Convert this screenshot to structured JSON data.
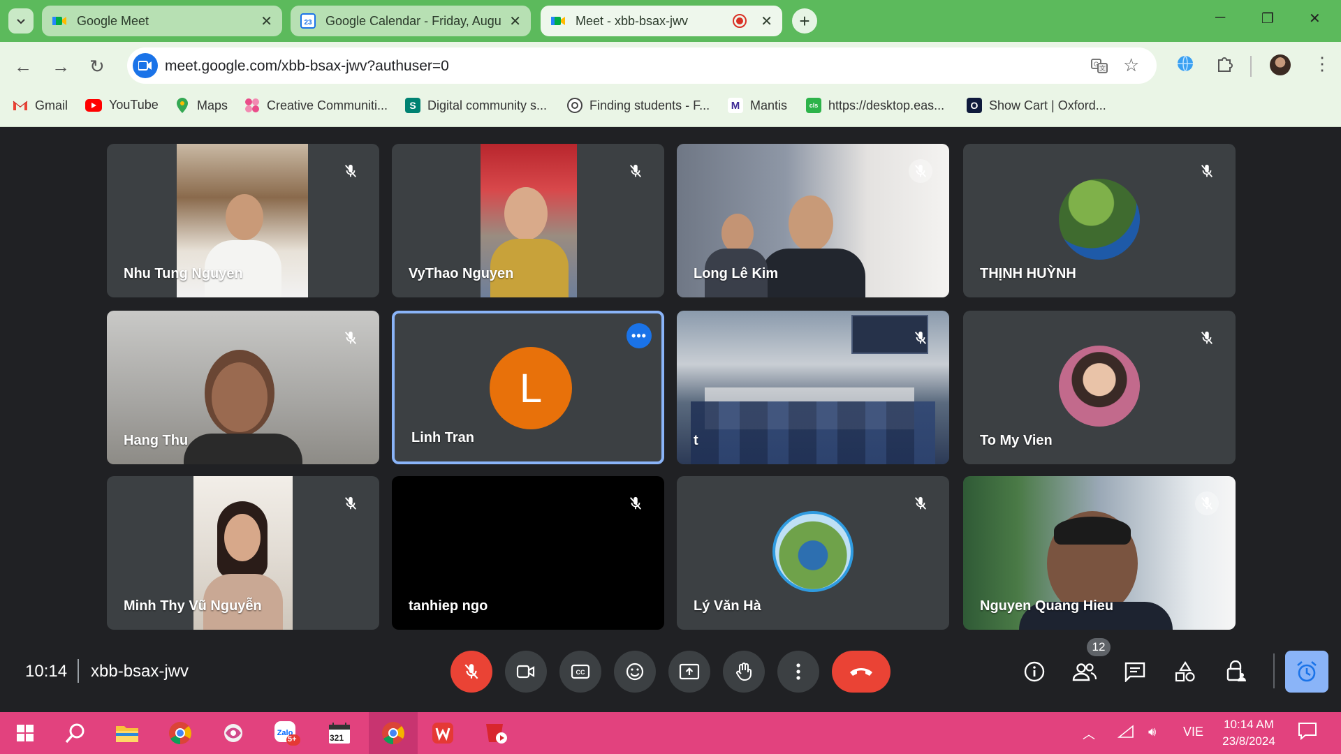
{
  "browser": {
    "tabs": [
      {
        "title": "Google Meet",
        "active": false
      },
      {
        "title": "Google Calendar - Friday, Augu",
        "active": false
      },
      {
        "title": "Meet - xbb-bsax-jwv",
        "active": true,
        "recording": true
      }
    ],
    "url": "meet.google.com/xbb-bsax-jwv?authuser=0",
    "bookmarks": [
      {
        "label": "Gmail",
        "icon": "gmail-icon"
      },
      {
        "label": "YouTube",
        "icon": "youtube-icon"
      },
      {
        "label": "Maps",
        "icon": "maps-icon"
      },
      {
        "label": "Creative Communiti...",
        "icon": "creative-community-icon"
      },
      {
        "label": "Digital community s...",
        "icon": "sway-icon"
      },
      {
        "label": "Finding students - F...",
        "icon": "finding-students-icon"
      },
      {
        "label": "Mantis",
        "icon": "mantis-icon"
      },
      {
        "label": "https://desktop.eas...",
        "icon": "class-icon"
      },
      {
        "label": "Show Cart | Oxford...",
        "icon": "oxford-icon"
      }
    ]
  },
  "meet": {
    "participants": [
      {
        "name": "Nhu Tung Nguyen",
        "muted": true
      },
      {
        "name": "VyThao Nguyen",
        "muted": true
      },
      {
        "name": "Long Lê Kim",
        "muted": true
      },
      {
        "name": "THỊNH HUỲNH",
        "muted": true
      },
      {
        "name": "Hang Thu",
        "muted": true
      },
      {
        "name": "Linh Tran",
        "muted": false,
        "initial": "L",
        "selected": true
      },
      {
        "name": "t",
        "muted": true
      },
      {
        "name": "To My Vien",
        "muted": true
      },
      {
        "name": "Minh Thy Vũ Nguyễn",
        "muted": true
      },
      {
        "name": "tanhiep ngo",
        "muted": true
      },
      {
        "name": "Lý Văn Hà",
        "muted": true
      },
      {
        "name": "Nguyen Quang Hieu",
        "muted": true
      }
    ],
    "time": "10:14",
    "meeting_code": "xbb-bsax-jwv",
    "participant_count": "12",
    "colors": {
      "accent": "#8ab4f8",
      "danger": "#ea4335",
      "avatar_orange": "#e8710a"
    }
  },
  "taskbar": {
    "language": "VIE",
    "time": "10:14 AM",
    "date": "23/8/2024",
    "zalo_badge": "5+",
    "calendar_badge": "321"
  }
}
